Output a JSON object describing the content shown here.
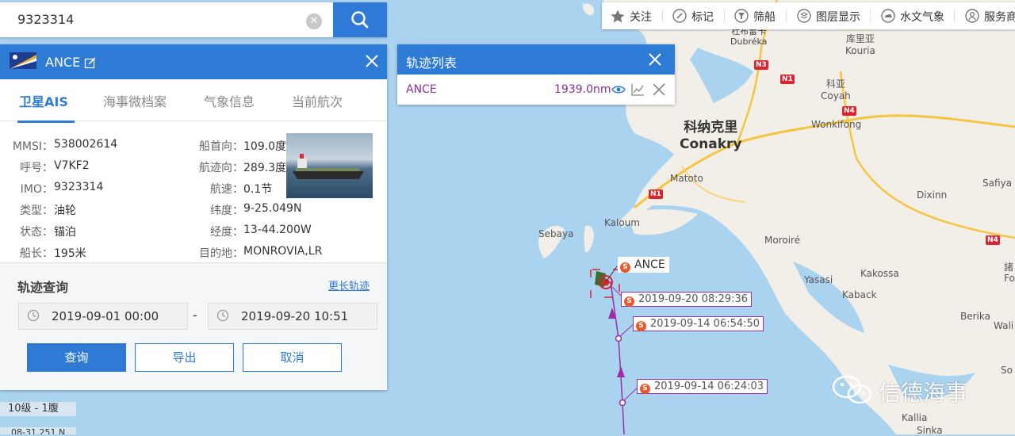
{
  "search": {
    "value": "9323314"
  },
  "ship": {
    "name": "ANCE",
    "tabs": [
      "卫星AIS",
      "海事微档案",
      "气象信息",
      "当前航次"
    ],
    "left": [
      {
        "label": "MMSI：",
        "value": "538002614"
      },
      {
        "label": "呼号：",
        "value": "V7KF2"
      },
      {
        "label": "IMO：",
        "value": "9323314"
      },
      {
        "label": "类型：",
        "value": "油轮"
      },
      {
        "label": "状态：",
        "value": "锚泊"
      },
      {
        "label": "船长：",
        "value": "195米"
      }
    ],
    "right": [
      {
        "label": "船首向：",
        "value": "109.0度"
      },
      {
        "label": "航迹向：",
        "value": "289.3度"
      },
      {
        "label": "航速：",
        "value": "0.1节"
      },
      {
        "label": "纬度：",
        "value": "9-25.049N"
      },
      {
        "label": "经度：",
        "value": "13-44.200W"
      },
      {
        "label": "目的地：",
        "value": "MONROVIA,LR"
      }
    ]
  },
  "track_query": {
    "title": "轨迹查询",
    "more_link": "更长轨迹",
    "start": "2019-09-01 00:00",
    "separator": "-",
    "end": "2019-09-20 10:51",
    "buttons": {
      "query": "查询",
      "export": "导出",
      "cancel": "取消"
    }
  },
  "track_list": {
    "title": "轨迹列表",
    "rows": [
      {
        "name": "ANCE",
        "distance": "1939.0nm"
      }
    ]
  },
  "toolbar": {
    "items": [
      {
        "label": "关注",
        "icon": "star-icon"
      },
      {
        "label": "标记",
        "icon": "tag-icon"
      },
      {
        "label": "筛船",
        "icon": "filter-icon"
      },
      {
        "label": "图层显示",
        "icon": "layers-icon"
      },
      {
        "label": "水文气象",
        "icon": "weather-icon"
      },
      {
        "label": "服务商",
        "icon": "service-icon"
      }
    ]
  },
  "map": {
    "ship_label": "ANCE",
    "timestamps": [
      "2019-09-20 08:29:36",
      "2019-09-14 06:54:50",
      "2019-09-14 06:24:03"
    ],
    "stamp_badge": "S",
    "places": [
      {
        "id": "dubreka",
        "text": "杜布雷卡\nDubréka"
      },
      {
        "id": "kouria",
        "text": "库里亚\nKouria"
      },
      {
        "id": "coyah",
        "text": "科亚\nCoyah"
      },
      {
        "id": "wonkifong",
        "text": "Wonkifong"
      },
      {
        "id": "conakry",
        "text": "科纳克里\nConakry"
      },
      {
        "id": "matoto",
        "text": "Matoto"
      },
      {
        "id": "kaloum",
        "text": "Kaloum"
      },
      {
        "id": "sebaya",
        "text": "Sebaya"
      },
      {
        "id": "dixinn",
        "text": "Dixinn"
      },
      {
        "id": "safiya",
        "text": "Safiya"
      },
      {
        "id": "moroire",
        "text": "Moroiré"
      },
      {
        "id": "yasasi",
        "text": "Yasasi"
      },
      {
        "id": "kakossa",
        "text": "Kakossa"
      },
      {
        "id": "kaback",
        "text": "Kaback"
      },
      {
        "id": "berika",
        "text": "Berika"
      },
      {
        "id": "wali",
        "text": "Wali"
      },
      {
        "id": "kallia",
        "text": "Kallia"
      },
      {
        "id": "sinka",
        "text": "Sinka"
      },
      {
        "id": "so",
        "text": "So"
      },
      {
        "id": "fo",
        "text": "諸\nFo"
      }
    ],
    "roads": [
      "N3",
      "N1",
      "N4",
      "N1",
      "N4"
    ],
    "scale": "10级 - 1腹",
    "coord": "08-31.251 N",
    "watermark": "信德海事"
  },
  "colors": {
    "accent": "#2e7bd6",
    "track": "#8a2d9e",
    "sea": "#aad3f0",
    "land": "#f2efe9"
  }
}
